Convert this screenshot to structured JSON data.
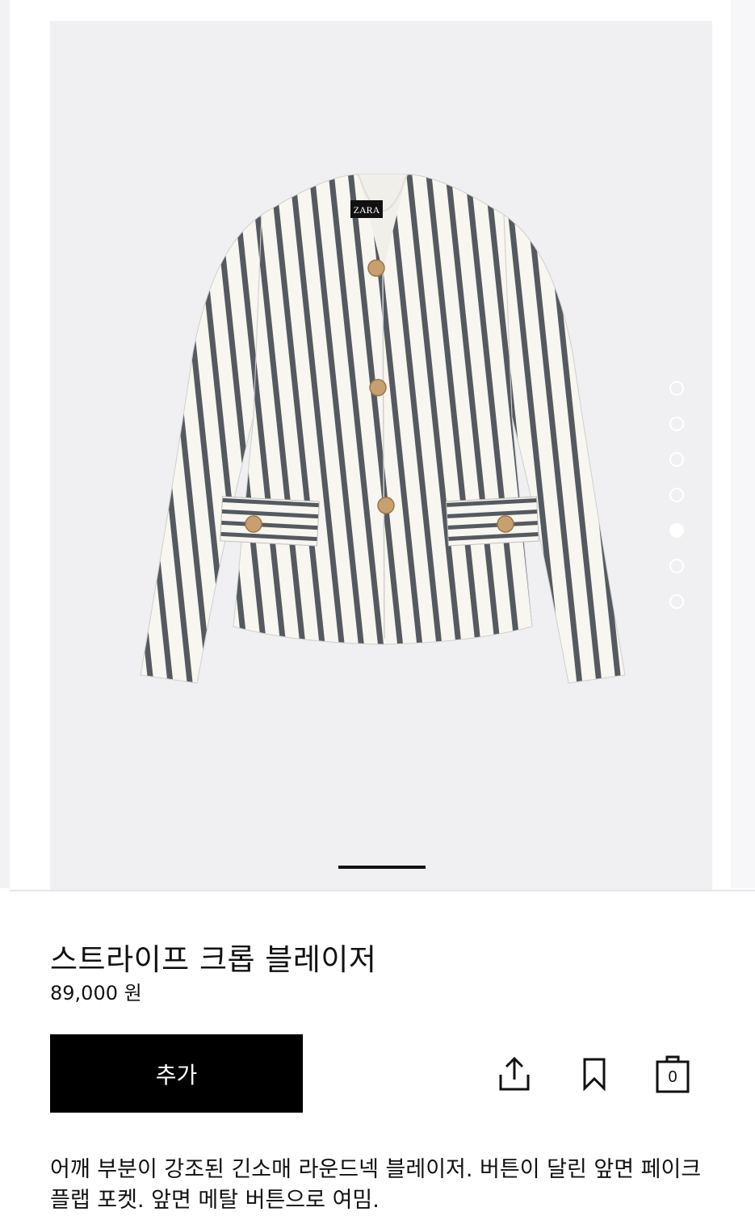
{
  "product": {
    "title": "스트라이프 크롭 블레이저",
    "price": "89,000 원",
    "description": "어깨 부분이 강조된 긴소매 라운드넥 블레이저. 버튼이 달린 앞면 페이크 플랩 포켓. 앞면 메탈 버튼으로 여밈.",
    "image": {
      "label_text": "ZARA",
      "stripe_color": "#555a60",
      "fabric_color": "#f8f6f0",
      "button_color": "#c8a070"
    }
  },
  "gallery": {
    "dot_count": 7,
    "active_dot_index": 4
  },
  "actions": {
    "add_label": "추가",
    "share_icon": "share-icon",
    "bookmark_icon": "bookmark-icon",
    "bag_icon": "shopping-bag-icon",
    "bag_count": "0"
  },
  "colors": {
    "primary_button": "#000000",
    "gallery_background": "#f0f0f2"
  }
}
